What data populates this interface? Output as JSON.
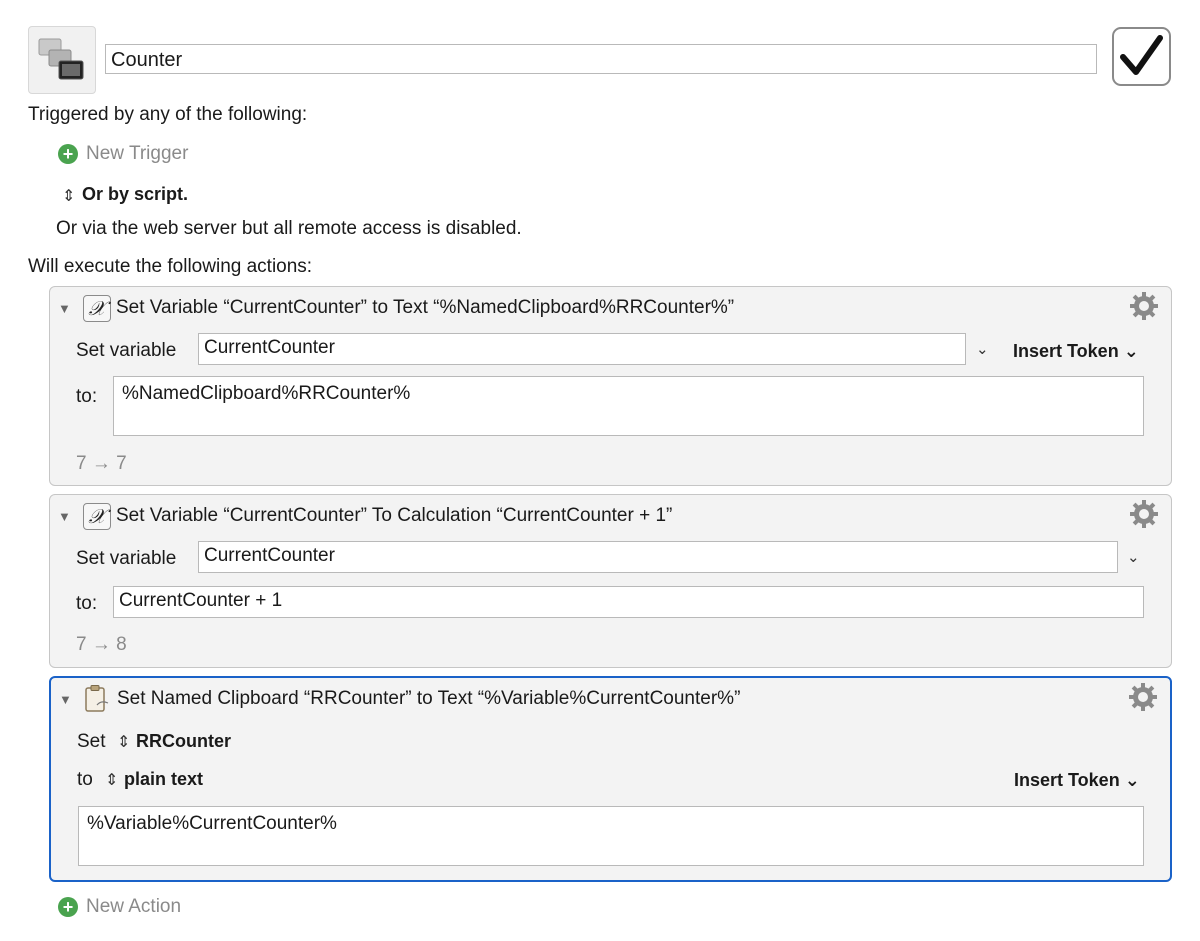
{
  "macro": {
    "name": "Counter"
  },
  "triggers": {
    "heading": "Triggered by any of the following:",
    "new_trigger": "New Trigger",
    "or_by_script": "Or by script.",
    "web_server_note": "Or via the web server but all remote access is disabled."
  },
  "actions_heading": "Will execute the following actions:",
  "actions": [
    {
      "title": "Set Variable “CurrentCounter” to Text “%NamedClipboard%RRCounter%”",
      "set_label": "Set variable",
      "variable": "CurrentCounter",
      "insert_token": "Insert Token",
      "to_label": "to:",
      "text": "%NamedClipboard%RRCounter%",
      "result": "7 → 7"
    },
    {
      "title": "Set Variable “CurrentCounter” To Calculation “CurrentCounter + 1”",
      "set_label": "Set variable",
      "variable": "CurrentCounter",
      "to_label": "to:",
      "calculation": "CurrentCounter + 1",
      "result": "7 → 8"
    },
    {
      "title": "Set Named Clipboard “RRCounter” to Text “%Variable%CurrentCounter%”",
      "set_label": "Set",
      "clipboard": "RRCounter",
      "to_label": "to",
      "format": "plain text",
      "insert_token": "Insert Token",
      "text": "%Variable%CurrentCounter%"
    }
  ],
  "new_action": "New Action",
  "colors": {
    "selected_border": "#1a62c8",
    "add_green": "#4aa34f"
  },
  "icons": [
    "macro-group-icon",
    "checkmark-icon",
    "add-icon",
    "variable-x-icon",
    "gear-icon",
    "clipboard-icon",
    "disclosure-triangle-icon",
    "chevron-down-icon",
    "up-down-arrows-icon"
  ]
}
